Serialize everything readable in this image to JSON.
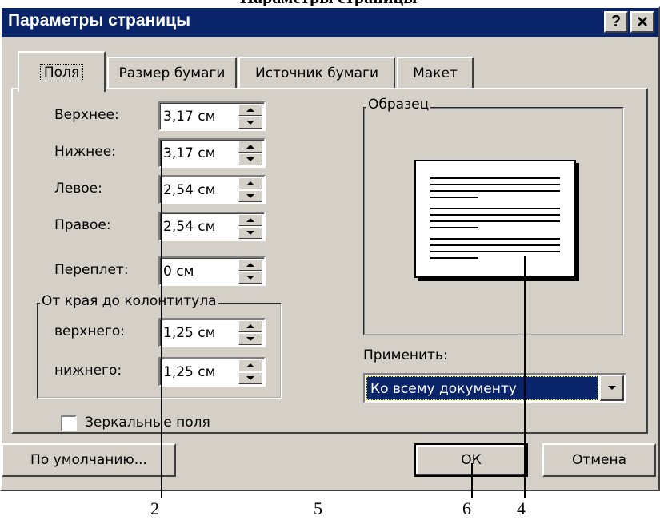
{
  "caption_partial": "Параметры страницы",
  "window": {
    "title": "Параметры страницы",
    "help_button": "?",
    "close_button": "×"
  },
  "tabs": [
    {
      "label": "Поля",
      "active": true
    },
    {
      "label": "Размер бумаги",
      "active": false
    },
    {
      "label": "Источник бумаги",
      "active": false
    },
    {
      "label": "Макет",
      "active": false
    }
  ],
  "margins": {
    "top": {
      "label": "Верхнее:",
      "value": "3,17 см"
    },
    "bottom": {
      "label": "Нижнее:",
      "value": "3,17 см"
    },
    "left": {
      "label": "Левое:",
      "value": "2,54 см"
    },
    "right": {
      "label": "Правое:",
      "value": "2,54 см"
    },
    "gutter": {
      "label": "Переплет:",
      "value": "0 см"
    }
  },
  "header_footer_group": {
    "legend": "От края до колонтитула",
    "header": {
      "label": "верхнего:",
      "value": "1,25 см"
    },
    "footer": {
      "label": "нижнего:",
      "value": "1,25 см"
    }
  },
  "preview": {
    "legend": "Образец"
  },
  "apply": {
    "label": "Применить:",
    "selected": "Ко всему документу"
  },
  "mirror_margins": {
    "label": "Зеркальные поля",
    "checked": false
  },
  "buttons": {
    "default": "По умолчанию...",
    "ok": "ОК",
    "cancel": "Отмена"
  },
  "callouts": [
    "2",
    "5",
    "6",
    "4"
  ]
}
